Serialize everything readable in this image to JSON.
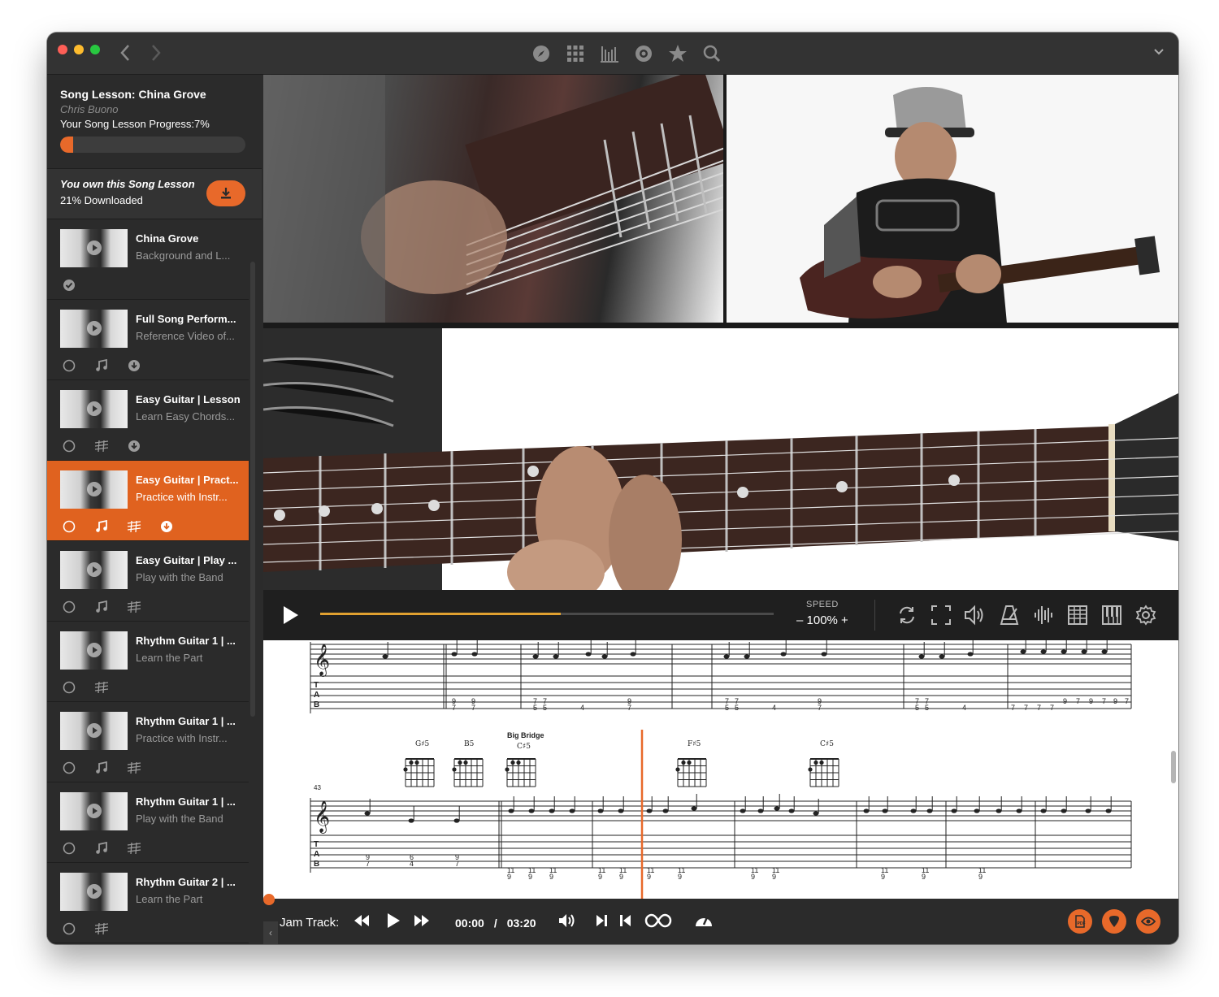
{
  "toolbar": {
    "icons": [
      "compass-icon",
      "grid-icon",
      "library-bars-icon",
      "disc-icon",
      "star-icon",
      "search-icon"
    ]
  },
  "lesson_header": {
    "title": "Song Lesson: China Grove",
    "author": "Chris Buono",
    "progress_label": "Your Song Lesson Progress:7%",
    "progress": 0.07
  },
  "ownership": {
    "owned_text": "You own this Song Lesson",
    "downloaded_text": "21% Downloaded"
  },
  "lessons": [
    {
      "title": "China Grove",
      "subtitle": "Background and L...",
      "icons": [
        "check-circle-icon"
      ],
      "active": false
    },
    {
      "title": "Full Song Perform...",
      "subtitle": "Reference Video of...",
      "icons": [
        "circle-icon",
        "music-note-icon",
        "download-icon"
      ],
      "active": false
    },
    {
      "title": "Easy Guitar | Lesson",
      "subtitle": "Learn Easy Chords...",
      "icons": [
        "circle-icon",
        "tab-icon",
        "download-icon"
      ],
      "active": false
    },
    {
      "title": "Easy Guitar | Pract...",
      "subtitle": "Practice with Instr...",
      "icons": [
        "circle-icon",
        "music-note-icon",
        "tab-icon",
        "download-icon"
      ],
      "active": true
    },
    {
      "title": "Easy Guitar | Play ...",
      "subtitle": "Play with the Band",
      "icons": [
        "circle-icon",
        "music-note-icon",
        "tab-icon"
      ],
      "active": false
    },
    {
      "title": "Rhythm Guitar 1 | ...",
      "subtitle": "Learn the Part",
      "icons": [
        "circle-icon",
        "tab-icon"
      ],
      "active": false
    },
    {
      "title": "Rhythm Guitar 1 | ...",
      "subtitle": "Practice with Instr...",
      "icons": [
        "circle-icon",
        "music-note-icon",
        "tab-icon"
      ],
      "active": false
    },
    {
      "title": "Rhythm Guitar 1 | ...",
      "subtitle": "Play with the Band",
      "icons": [
        "circle-icon",
        "music-note-icon",
        "tab-icon"
      ],
      "active": false
    },
    {
      "title": "Rhythm Guitar 2 | ...",
      "subtitle": "Learn the Part",
      "icons": [
        "circle-icon",
        "tab-icon"
      ],
      "active": false
    }
  ],
  "player": {
    "progress": 0.53,
    "speed_label": "SPEED",
    "speed_value": "– 100% +",
    "tool_icons": [
      "loop-icon",
      "fullscreen-icon",
      "volume-icon",
      "metronome-icon",
      "waveform-icon",
      "fretboard-grid-icon",
      "piano-icon",
      "settings-gear-icon"
    ]
  },
  "notation": {
    "measure_number": "43",
    "section_label": "Big Bridge",
    "chords": [
      "G♯5",
      "B5",
      "C♯5",
      "F♯5",
      "C♯5"
    ],
    "tab_row1": [
      "9",
      "7",
      "9",
      "7",
      "7",
      "7",
      "5",
      "5",
      "4",
      "9",
      "7",
      "7",
      "7",
      "5",
      "5",
      "4",
      "9",
      "7",
      "7",
      "7",
      "5",
      "5",
      "4",
      "7",
      "7",
      "7",
      "7",
      "9",
      "7",
      "9",
      "7",
      "9",
      "7"
    ],
    "tab_row2": [
      "9",
      "7",
      "6",
      "4",
      "9",
      "7",
      "11",
      "9",
      "11",
      "9",
      "11",
      "9",
      "11",
      "9",
      "11",
      "9",
      "11",
      "9",
      "11",
      "9",
      "11",
      "9",
      "11",
      "9",
      "11",
      "9",
      "11",
      "9",
      "11",
      "9"
    ]
  },
  "jam_track": {
    "label": "Jam Track:",
    "current_time": "00:00",
    "separator": "/",
    "total_time": "03:20",
    "icons": [
      "rewind-icon",
      "play-icon",
      "fast-forward-icon",
      "volume-icon",
      "skip-end-icon",
      "skip-start-icon",
      "loop-infinity-icon",
      "speedometer-icon"
    ],
    "action_buttons": [
      "pdf-icon",
      "guitar-pick-icon",
      "eye-icon"
    ]
  }
}
